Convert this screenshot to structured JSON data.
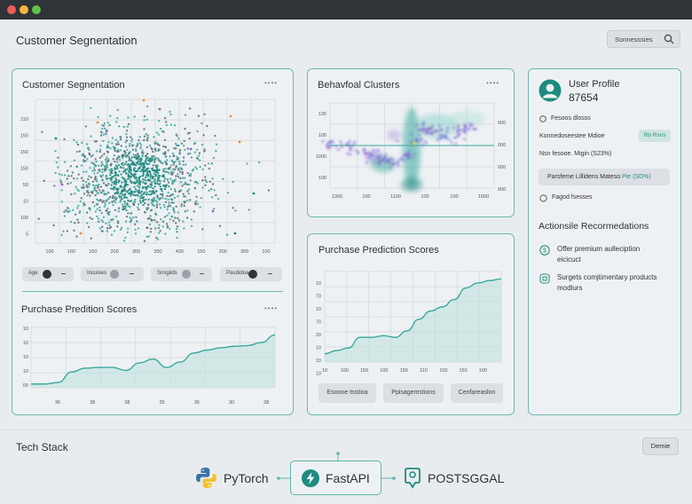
{
  "window": {
    "title": "Customer Segnentation"
  },
  "search": {
    "label": "Sonnesssies",
    "icon": "search-icon"
  },
  "scatter_card": {
    "title": "Customer Segnentation",
    "controls": [
      {
        "label": "Age",
        "knob": "dark"
      },
      {
        "label": "Incuises",
        "knob": "light"
      },
      {
        "label": "Snsgiids",
        "knob": "light"
      },
      {
        "label": "Paudidoa",
        "knob": "dark"
      }
    ]
  },
  "behavioral_card": {
    "title": "Behavfoal Clusters"
  },
  "purchase_left_card": {
    "title": "Purchase Predition Scores"
  },
  "purchase_right_card": {
    "title": "Purchase Prediction Scores",
    "buttons": [
      "Esoone tsstioa",
      "Ppisagemstions",
      "Cenfareaslon"
    ]
  },
  "profile": {
    "name": "User Profile",
    "id": "87654",
    "row1": "Fesoos dlosss",
    "row2_label": "Konnedoseestee Mdioe",
    "badge": "Rb Rsns",
    "row3": "Nsn fesooe. Migin (S23%)",
    "highlight_text": "Parsfeme Lillidens Mateso ",
    "highlight_accent": "Pie (SD%)",
    "row5": "Fagod fsesses",
    "rec_title": "Actionsile Recormedations",
    "recs": [
      {
        "line1": "Offer premium aulleciption",
        "line2": "eicicuct",
        "icon": "dollar-icon"
      },
      {
        "line1": "Surgets comjtimentary products",
        "line2": "modlurs",
        "icon": "tag-icon"
      }
    ]
  },
  "tech": {
    "title": "Tech Stack",
    "demo": "Demie",
    "items": [
      "PyTorch",
      "FastAPI",
      "POSTSGGAL"
    ]
  },
  "colors": {
    "accent": "#3aa99f",
    "teal_dark": "#1f8a80",
    "purple": "#8a63d2",
    "orange": "#f28c28"
  },
  "chart_data": [
    {
      "type": "scatter",
      "title": "Customer Segnentation",
      "x_ticks": [
        "100",
        "160",
        "160",
        "200",
        "300",
        "300",
        "400",
        "150",
        "200",
        "300",
        "100"
      ],
      "y_ticks": [
        "110",
        "150",
        "150",
        "150",
        "50",
        "10",
        "100",
        "5"
      ],
      "grid": true
    },
    {
      "type": "heatmap",
      "title": "Behavfoal Clusters",
      "x_ticks": [
        "1300",
        "100",
        "1100",
        "100",
        "100",
        "1000"
      ],
      "y_left_ticks": [
        "130",
        "100",
        "1000",
        "100"
      ],
      "y_right_ticks": [
        "000",
        "000",
        "000",
        "000"
      ],
      "grid": true
    },
    {
      "type": "area",
      "title": "Purchase Predition Scores",
      "x_ticks": [
        "36",
        "38",
        "38",
        "35",
        "36",
        "30",
        "38"
      ],
      "y_ticks": [
        "00",
        "10",
        "10",
        "10",
        "10"
      ],
      "series": [
        {
          "values": [
            5,
            5,
            7,
            21,
            26,
            27,
            27,
            23,
            33,
            38,
            27,
            34,
            46,
            50,
            53,
            55,
            56,
            60,
            70
          ]
        }
      ],
      "ylim": [
        0,
        80
      ],
      "grid": true
    },
    {
      "type": "area",
      "title": "Purchase Prediction Scores",
      "x_ticks": [
        "10",
        "100",
        "150",
        "100",
        "190",
        "110",
        "100",
        "150",
        "100"
      ],
      "y_ticks": [
        "10",
        "70",
        "10",
        "70",
        "20",
        "10",
        "10",
        "10"
      ],
      "series": [
        {
          "values": [
            10,
            14,
            17,
            30,
            30,
            32,
            30,
            38,
            52,
            62,
            67,
            76,
            90,
            96,
            99,
            101
          ]
        }
      ],
      "ylim": [
        0,
        110
      ],
      "grid": true
    }
  ]
}
